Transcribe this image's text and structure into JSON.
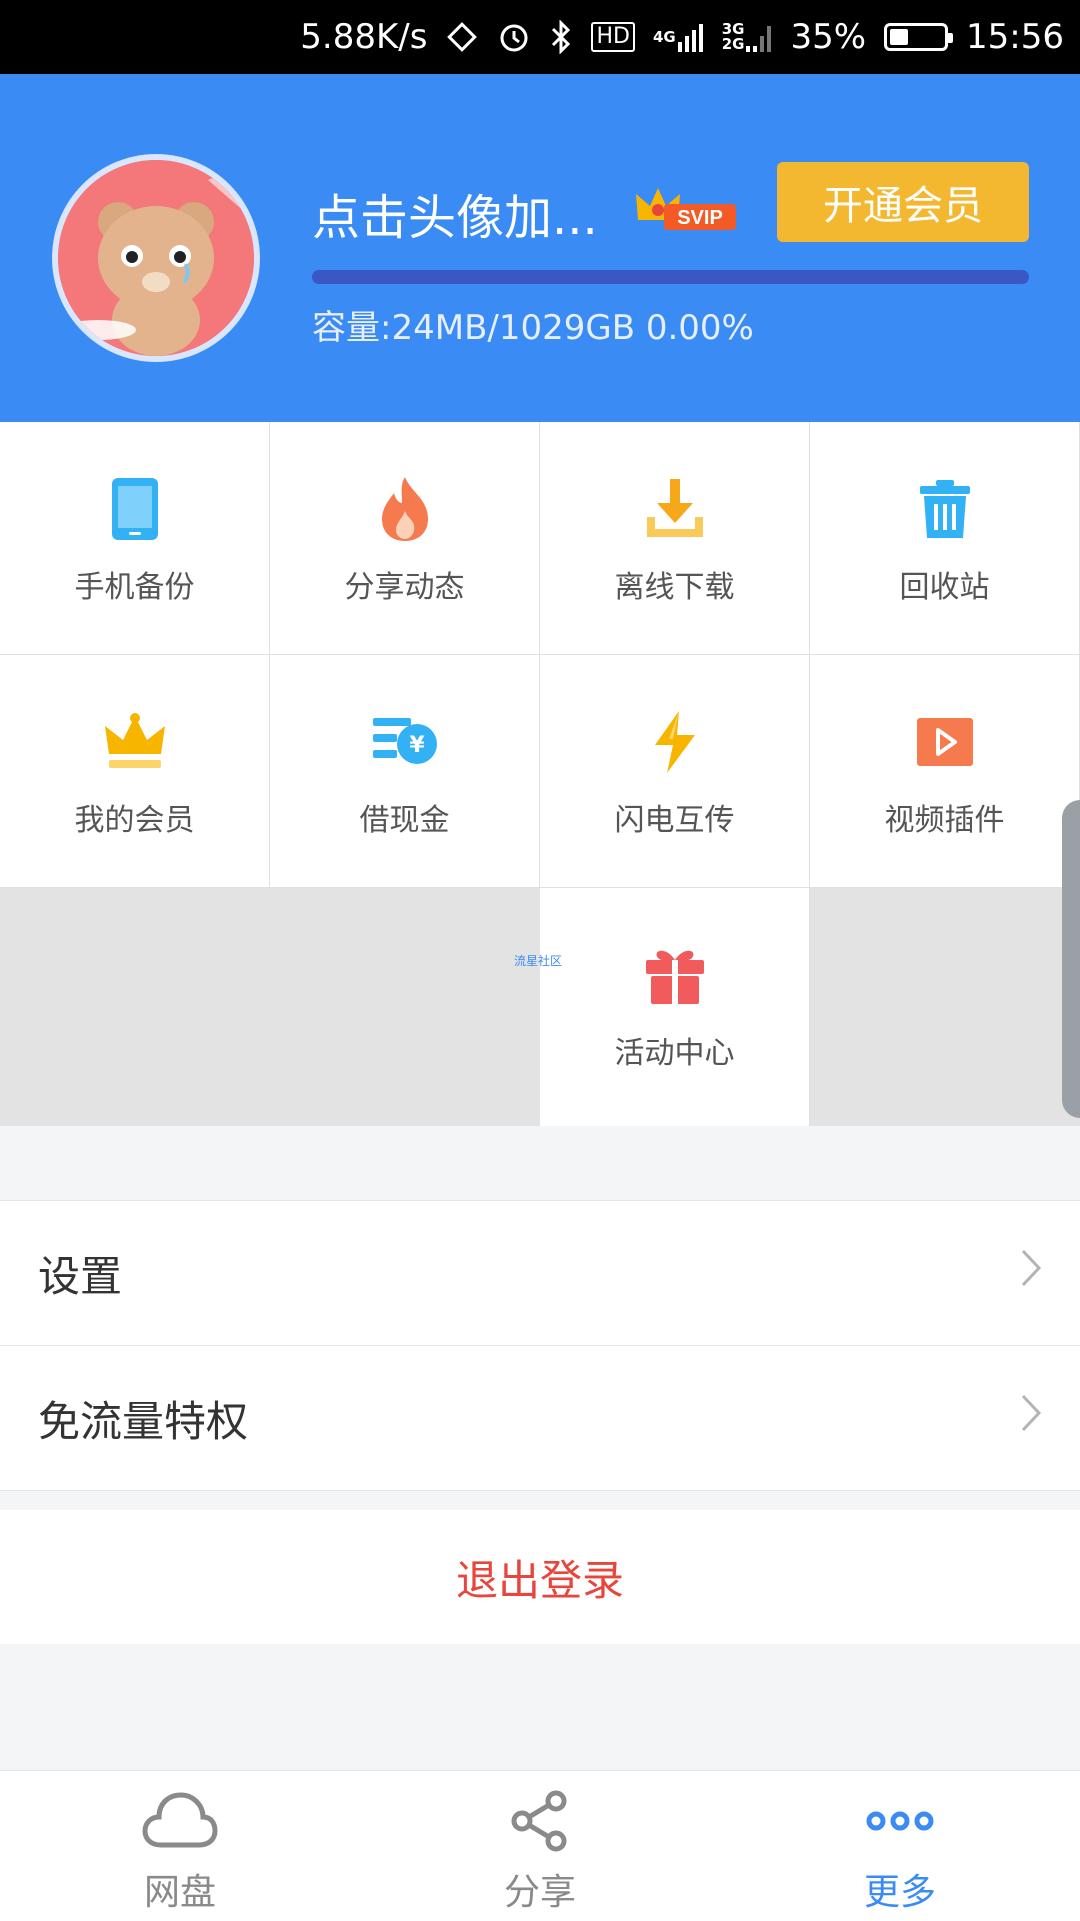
{
  "status_bar": {
    "net_speed": "5.88K/s",
    "hd": "HD",
    "sig1": "4G",
    "sig2": "3G",
    "sig2b": "2G",
    "battery": "35%",
    "battery_level": 0.35,
    "time": "15:56"
  },
  "header": {
    "username": "点击头像加...",
    "badge": "SVIP",
    "vip_button": "开通会员",
    "quota_label": "容量:",
    "quota_value": "24MB/1029GB 0.00%",
    "quota_used_fraction": 0.0,
    "bg_color": "#3b8bf4"
  },
  "grid": {
    "items": [
      {
        "label": "手机备份",
        "icon": "phone-icon"
      },
      {
        "label": "分享动态",
        "icon": "flame-icon"
      },
      {
        "label": "离线下载",
        "icon": "download-icon"
      },
      {
        "label": "回收站",
        "icon": "trash-icon"
      },
      {
        "label": "我的会员",
        "icon": "crown-icon"
      },
      {
        "label": "借现金",
        "icon": "cash-icon"
      },
      {
        "label": "闪电互传",
        "icon": "lightning-icon"
      },
      {
        "label": "视频插件",
        "icon": "video-play-icon"
      },
      {
        "label": "活动中心",
        "icon": "gift-icon"
      }
    ],
    "watermark": "流星社区"
  },
  "menu": {
    "settings": "设置",
    "free_data": "免流量特权",
    "logout": "退出登录"
  },
  "bottom_nav": {
    "items": [
      {
        "label": "网盘",
        "icon": "cloud-icon"
      },
      {
        "label": "分享",
        "icon": "share-icon"
      },
      {
        "label": "更多",
        "icon": "more-icon"
      }
    ],
    "active_color": "#3b8bf4"
  }
}
